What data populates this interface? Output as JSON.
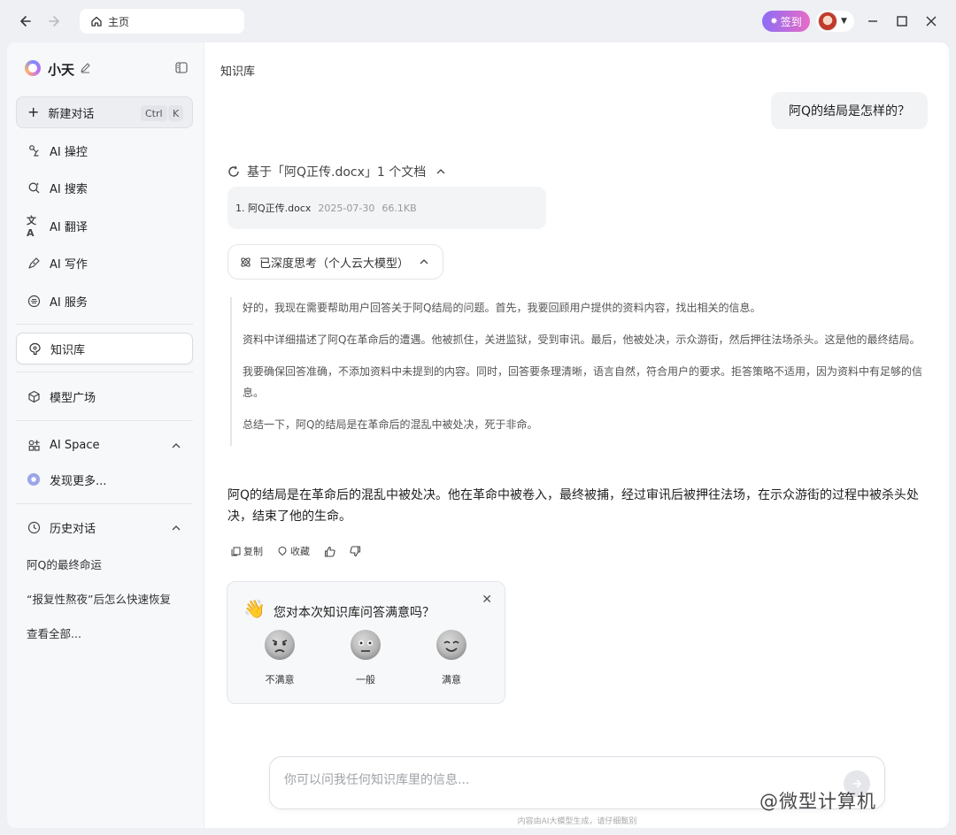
{
  "topbar": {
    "address_label": "主页",
    "signin_label": "签到"
  },
  "sidebar": {
    "app_name": "小天",
    "new_chat": {
      "label": "新建对话",
      "kbd1": "Ctrl",
      "kbd2": "K"
    },
    "items": [
      {
        "label": "AI 操控"
      },
      {
        "label": "AI 搜索"
      },
      {
        "label": "AI 翻译"
      },
      {
        "label": "AI 写作"
      },
      {
        "label": "AI 服务"
      },
      {
        "label": "知识库"
      },
      {
        "label": "模型广场"
      },
      {
        "label": "AI Space"
      },
      {
        "label": "发现更多..."
      },
      {
        "label": "历史对话"
      }
    ],
    "history": [
      "阿Q的最终命运",
      "“报复性熬夜”后怎么快速恢复",
      "查看全部..."
    ]
  },
  "main": {
    "page_title": "知识库",
    "user_question": "阿Q的结局是怎样的？",
    "source_header": "基于「阿Q正传.docx」1 个文档",
    "doc": {
      "name": "1. 阿Q正传.docx",
      "date": "2025-07-30",
      "size": "66.1KB"
    },
    "thinking_label": "已深度思考（个人云大模型）",
    "thinking": [
      "好的，我现在需要帮助用户回答关于阿Q结局的问题。首先，我要回顾用户提供的资料内容，找出相关的信息。",
      "资料中详细描述了阿Q在革命后的遭遇。他被抓住，关进监狱，受到审讯。最后，他被处决，示众游街，然后押往法场杀头。这是他的最终结局。",
      "我要确保回答准确，不添加资料中未提到的内容。同时，回答要条理清晰，语言自然，符合用户的要求。拒答策略不适用，因为资料中有足够的信息。",
      "总结一下，阿Q的结局是在革命后的混乱中被处决，死于非命。"
    ],
    "answer": "阿Q的结局是在革命后的混乱中被处决。他在革命中被卷入，最终被捕，经过审讯后被押往法场，在示众游街的过程中被杀头处决，结束了他的生命。",
    "actions": {
      "copy": "复制",
      "favorite": "收藏"
    },
    "feedback": {
      "title": "您对本次知识库问答满意吗？",
      "options": [
        "不满意",
        "一般",
        "满意"
      ]
    },
    "input_placeholder": "你可以问我任何知识库里的信息...",
    "disclaimer": "内容由AI大模型生成，请仔细甄别"
  },
  "watermark": "@微型计算机",
  "colors": {
    "accent": "#8c6df5",
    "signin_gradient_end": "#e86cc6",
    "background": "#eef0f4"
  }
}
